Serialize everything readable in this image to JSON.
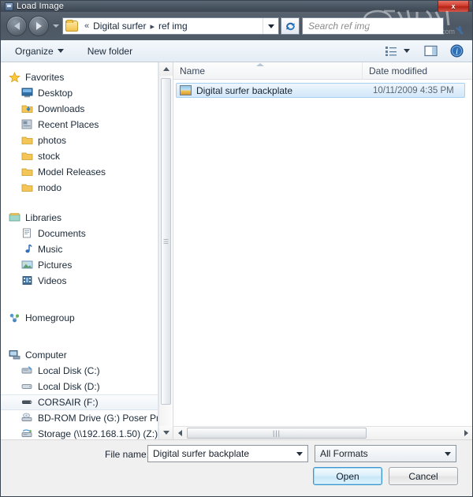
{
  "window": {
    "title": "Load Image",
    "title_icon": "app-image-icon",
    "close_label": "x"
  },
  "nav": {
    "back_icon": "back-arrow-icon",
    "forward_icon": "forward-arrow-icon",
    "history_icon": "chevron-down-icon",
    "breadcrumb_prefix": "«",
    "breadcrumb": [
      "Digital surfer",
      "ref img"
    ],
    "breadcrumb_separator": "▸",
    "address_dropdown_icon": "chevron-down-icon",
    "refresh_icon": "refresh-icon",
    "folder_icon": "folder-icon"
  },
  "search": {
    "placeholder": "Search ref img",
    "icon": "search-icon"
  },
  "watermark": {
    "text": "www.hxsd.com"
  },
  "command_bar": {
    "organize_label": "Organize",
    "organize_caret_icon": "caret-down-icon",
    "new_folder_label": "New folder",
    "view_icon": "view-list-icon",
    "view_caret_icon": "caret-down-icon",
    "preview_pane_icon": "preview-pane-icon",
    "help_icon": "help-icon"
  },
  "sidebar": {
    "groups": [
      {
        "label": "Favorites",
        "icon": "star-icon",
        "items": [
          {
            "label": "Desktop",
            "icon": "desktop-icon"
          },
          {
            "label": "Downloads",
            "icon": "downloads-folder-icon"
          },
          {
            "label": "Recent Places",
            "icon": "recent-places-icon"
          },
          {
            "label": "photos",
            "icon": "folder-icon"
          },
          {
            "label": "stock",
            "icon": "folder-icon"
          },
          {
            "label": "Model Releases",
            "icon": "folder-icon"
          },
          {
            "label": "modo",
            "icon": "folder-icon"
          }
        ]
      },
      {
        "label": "Libraries",
        "icon": "libraries-icon",
        "items": [
          {
            "label": "Documents",
            "icon": "documents-icon"
          },
          {
            "label": "Music",
            "icon": "music-icon"
          },
          {
            "label": "Pictures",
            "icon": "pictures-icon"
          },
          {
            "label": "Videos",
            "icon": "videos-icon"
          }
        ]
      },
      {
        "label": "Homegroup",
        "icon": "homegroup-icon",
        "items": []
      },
      {
        "label": "Computer",
        "icon": "computer-icon",
        "items": [
          {
            "label": "Local Disk (C:)",
            "icon": "system-drive-icon",
            "selected": false
          },
          {
            "label": "Local Disk (D:)",
            "icon": "drive-icon",
            "selected": false
          },
          {
            "label": "CORSAIR (F:)",
            "icon": "usb-drive-icon",
            "selected": true
          },
          {
            "label": "BD-ROM Drive (G:) Poser Pro",
            "icon": "optical-drive-icon",
            "selected": false
          },
          {
            "label": "Storage (\\\\192.168.1.50) (Z:)",
            "icon": "network-drive-icon",
            "selected": false
          }
        ]
      }
    ],
    "scrollbar": {
      "up_icon": "scroll-up-icon",
      "down_icon": "scroll-down-icon"
    }
  },
  "file_list": {
    "columns": [
      {
        "label": "Name",
        "sorted": true,
        "sort_icon": "sort-ascending-icon"
      },
      {
        "label": "Date modified",
        "sorted": false
      }
    ],
    "rows": [
      {
        "name": "Digital surfer backplate",
        "date_modified": "10/11/2009 4:35 PM",
        "icon": "image-file-icon",
        "selected": true
      }
    ],
    "hscrollbar": {
      "left_icon": "scroll-left-icon",
      "right_icon": "scroll-right-icon"
    }
  },
  "footer": {
    "file_name_label": "File name:",
    "file_name_value": "Digital surfer backplate",
    "file_name_caret_icon": "caret-down-icon",
    "format_value": "All Formats",
    "format_caret_icon": "caret-down-icon",
    "open_label": "Open",
    "cancel_label": "Cancel"
  },
  "colors": {
    "accent": "#3c97cf",
    "selection_border": "#a6d0ef",
    "titlebar": "#47525f",
    "close_button": "#cf3b2c",
    "chrome": "#f0f0f0"
  }
}
